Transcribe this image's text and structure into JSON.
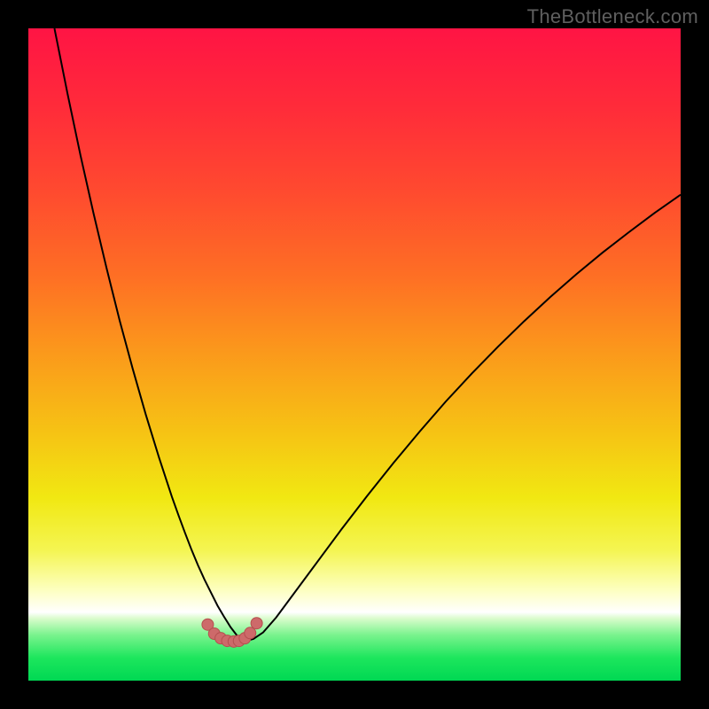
{
  "watermark": "TheBottleneck.com",
  "colors": {
    "page_bg": "#000000",
    "watermark_text": "#5f5f5f",
    "curve_stroke": "#000000",
    "marker_fill": "#cd6a6a",
    "marker_stroke": "#b54f4f",
    "gradient_stops": [
      {
        "offset": 0.0,
        "color": "#ff1444"
      },
      {
        "offset": 0.12,
        "color": "#ff2b3a"
      },
      {
        "offset": 0.25,
        "color": "#ff4a2f"
      },
      {
        "offset": 0.38,
        "color": "#fe6f24"
      },
      {
        "offset": 0.5,
        "color": "#fb9a1b"
      },
      {
        "offset": 0.62,
        "color": "#f6c314"
      },
      {
        "offset": 0.72,
        "color": "#f1e812"
      },
      {
        "offset": 0.8,
        "color": "#f4f552"
      },
      {
        "offset": 0.86,
        "color": "#fdffbe"
      },
      {
        "offset": 0.895,
        "color": "#ffffff"
      },
      {
        "offset": 0.905,
        "color": "#d9fccb"
      },
      {
        "offset": 0.93,
        "color": "#79f38d"
      },
      {
        "offset": 0.965,
        "color": "#1de65d"
      },
      {
        "offset": 1.0,
        "color": "#00d853"
      }
    ]
  },
  "chart_data": {
    "type": "line",
    "title": "",
    "xlabel": "",
    "ylabel": "",
    "xlim": [
      0,
      100
    ],
    "ylim": [
      0,
      100
    ],
    "grid": false,
    "legend": false,
    "series": [
      {
        "name": "bottleneck-curve",
        "x": [
          4,
          6,
          8,
          10,
          12,
          14,
          16,
          18,
          20,
          22,
          23,
          24,
          25,
          25.5,
          26,
          26.5,
          27,
          28,
          29,
          30,
          31,
          32,
          32.4,
          33,
          34.5,
          36,
          38,
          40,
          44,
          48,
          52,
          56,
          60,
          64,
          68,
          72,
          76,
          80,
          84,
          88,
          92,
          96,
          100
        ],
        "y": [
          100,
          90,
          80.5,
          71.6,
          63.2,
          55.2,
          47.8,
          40.8,
          34.3,
          28.2,
          25.4,
          22.7,
          20.1,
          18.9,
          17.7,
          16.6,
          15.5,
          13.5,
          11.5,
          9.8,
          8.2,
          6.9,
          6.4,
          6.0,
          6.4,
          7.4,
          9.7,
          12.4,
          17.8,
          23.2,
          28.4,
          33.4,
          38.2,
          42.8,
          47.1,
          51.2,
          55.1,
          58.8,
          62.3,
          65.6,
          68.7,
          71.7,
          74.5
        ]
      }
    ],
    "markers": {
      "name": "bottom-cluster",
      "points": [
        {
          "x": 27.5,
          "y": 8.6
        },
        {
          "x": 28.5,
          "y": 7.2
        },
        {
          "x": 29.5,
          "y": 6.5
        },
        {
          "x": 30.5,
          "y": 6.1
        },
        {
          "x": 31.5,
          "y": 6.0
        },
        {
          "x": 32.3,
          "y": 6.1
        },
        {
          "x": 33.2,
          "y": 6.5
        },
        {
          "x": 34.0,
          "y": 7.3
        },
        {
          "x": 35.0,
          "y": 8.8
        }
      ],
      "radius_px": 6.5
    }
  }
}
